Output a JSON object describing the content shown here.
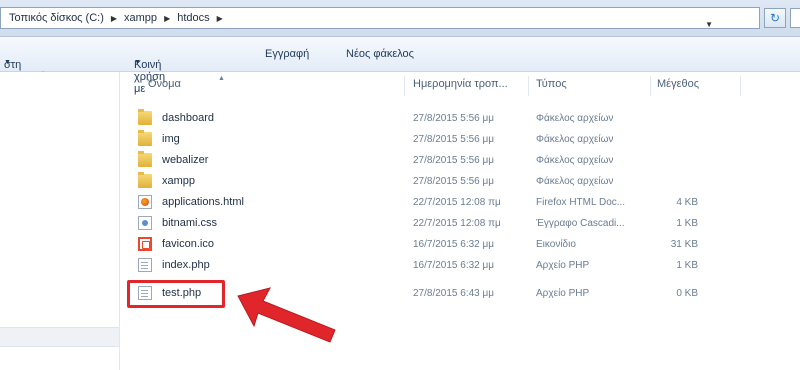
{
  "address_bar": {
    "crumbs": [
      "Τοπικός δίσκος (C:)",
      "xampp",
      "htdocs"
    ]
  },
  "toolbar": {
    "library_label": "στη βιβλιοθήκη",
    "share_label": "Κοινή χρήση με",
    "burn_label": "Εγγραφή",
    "new_folder_label": "Νέος φάκελος"
  },
  "columns": {
    "name": "Όνομα",
    "date": "Ημερομηνία τροπ...",
    "type": "Τύπος",
    "size": "Μέγεθος"
  },
  "files": [
    {
      "name": "dashboard",
      "date": "27/8/2015 5:56 μμ",
      "type": "Φάκελος αρχείων",
      "size": "",
      "icon": "folder-icon"
    },
    {
      "name": "img",
      "date": "27/8/2015 5:56 μμ",
      "type": "Φάκελος αρχείων",
      "size": "",
      "icon": "folder-icon"
    },
    {
      "name": "webalizer",
      "date": "27/8/2015 5:56 μμ",
      "type": "Φάκελος αρχείων",
      "size": "",
      "icon": "folder-icon"
    },
    {
      "name": "xampp",
      "date": "27/8/2015 5:56 μμ",
      "type": "Φάκελος αρχείων",
      "size": "",
      "icon": "folder-icon"
    },
    {
      "name": "applications.html",
      "date": "22/7/2015 12:08 πμ",
      "type": "Firefox HTML Doc...",
      "size": "4 KB",
      "icon": "firefox-html-icon"
    },
    {
      "name": "bitnami.css",
      "date": "22/7/2015 12:08 πμ",
      "type": "Έγγραφο Cascadi...",
      "size": "1 KB",
      "icon": "css-file-icon"
    },
    {
      "name": "favicon.ico",
      "date": "16/7/2015 6:32 μμ",
      "type": "Εικονίδιο",
      "size": "31 KB",
      "icon": "ico-file-icon"
    },
    {
      "name": "index.php",
      "date": "16/7/2015 6:32 μμ",
      "type": "Αρχείο PHP",
      "size": "1 KB",
      "icon": "php-file-icon"
    },
    {
      "name": "test.php",
      "date": "27/8/2015 6:43 μμ",
      "type": "Αρχείο PHP",
      "size": "0 KB",
      "icon": "php-file-icon"
    }
  ],
  "colors": {
    "highlight": "#e1262b",
    "text": "#1e2f45"
  }
}
